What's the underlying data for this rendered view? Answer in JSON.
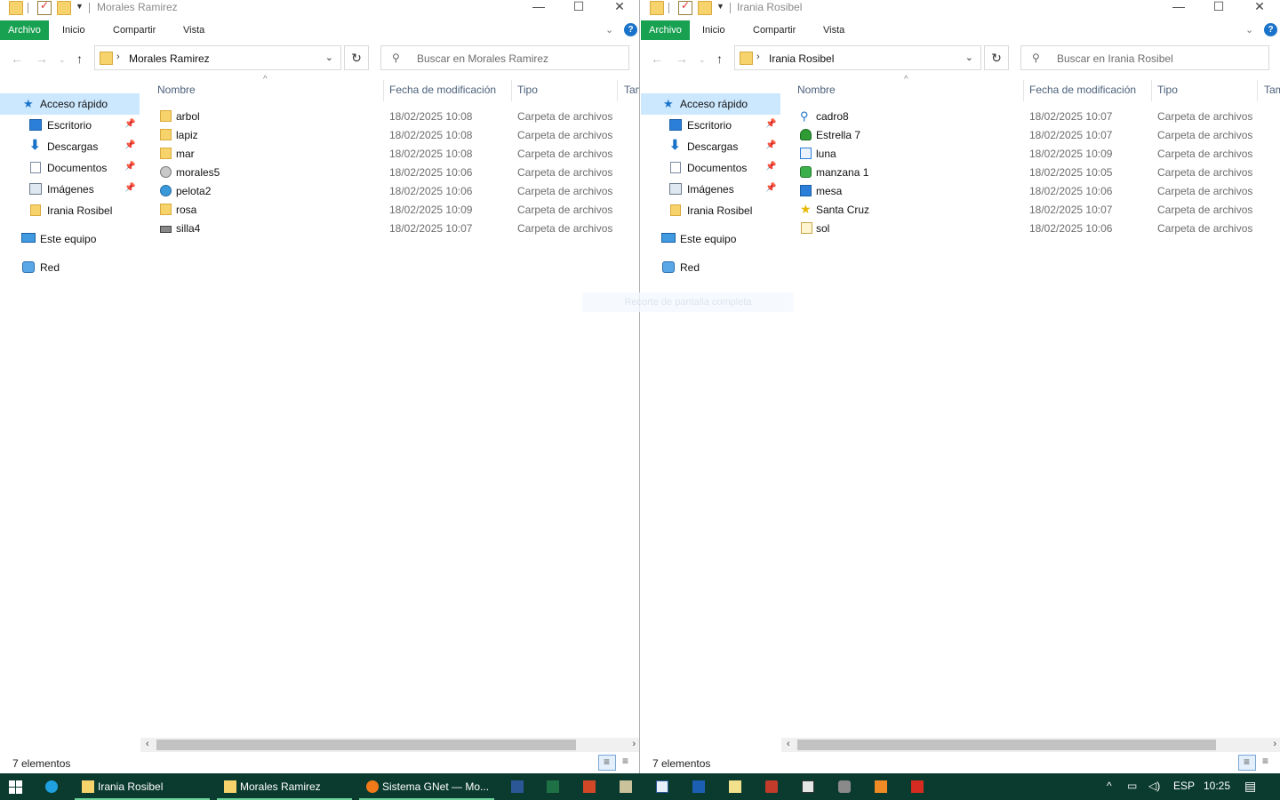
{
  "left": {
    "title": "Morales Ramirez",
    "ribbon": {
      "file": "Archivo",
      "home": "Inicio",
      "share": "Compartir",
      "view": "Vista"
    },
    "address": "Morales Ramirez",
    "search_placeholder": "Buscar en Morales Ramirez",
    "columns": {
      "name": "Nombre",
      "date": "Fecha de modificación",
      "type": "Tipo",
      "size": "Tam"
    },
    "files": [
      {
        "name": "arbol",
        "date": "18/02/2025 10:08",
        "type": "Carpeta de archivos",
        "icon": "folder-icon"
      },
      {
        "name": "lapiz",
        "date": "18/02/2025 10:08",
        "type": "Carpeta de archivos",
        "icon": "folder-icon"
      },
      {
        "name": "mar",
        "date": "18/02/2025 10:08",
        "type": "Carpeta de archivos",
        "icon": "folder-icon"
      },
      {
        "name": "morales5",
        "date": "18/02/2025 10:06",
        "type": "Carpeta de archivos",
        "icon": "disk-icon"
      },
      {
        "name": "pelota2",
        "date": "18/02/2025 10:06",
        "type": "Carpeta de archivos",
        "icon": "globe-icon"
      },
      {
        "name": "rosa",
        "date": "18/02/2025 10:09",
        "type": "Carpeta de archivos",
        "icon": "folder-icon"
      },
      {
        "name": "silla4",
        "date": "18/02/2025 10:07",
        "type": "Carpeta de archivos",
        "icon": "drive-icon"
      }
    ],
    "status": "7 elementos"
  },
  "right": {
    "title": "Irania Rosibel",
    "ribbon": {
      "file": "Archivo",
      "home": "Inicio",
      "share": "Compartir",
      "view": "Vista"
    },
    "address": "Irania Rosibel",
    "search_placeholder": "Buscar en Irania Rosibel",
    "columns": {
      "name": "Nombre",
      "date": "Fecha de modificación",
      "type": "Tipo",
      "size": "Tam"
    },
    "files": [
      {
        "name": "cadro8",
        "date": "18/02/2025 10:07",
        "type": "Carpeta de archivos",
        "icon": "search-icon"
      },
      {
        "name": "Estrella 7",
        "date": "18/02/2025 10:07",
        "type": "Carpeta de archivos",
        "icon": "tree-icon"
      },
      {
        "name": "luna",
        "date": "18/02/2025 10:09",
        "type": "Carpeta de archivos",
        "icon": "card-icon"
      },
      {
        "name": "manzana 1",
        "date": "18/02/2025 10:05",
        "type": "Carpeta de archivos",
        "icon": "network-icon"
      },
      {
        "name": "mesa",
        "date": "18/02/2025 10:06",
        "type": "Carpeta de archivos",
        "icon": "monitor-icon"
      },
      {
        "name": "Santa Cruz",
        "date": "18/02/2025 10:07",
        "type": "Carpeta de archivos",
        "icon": "star-icon"
      },
      {
        "name": "sol",
        "date": "18/02/2025 10:06",
        "type": "Carpeta de archivos",
        "icon": "document-icon"
      }
    ],
    "status": "7 elementos"
  },
  "nav": {
    "quick_access": "Acceso rápido",
    "desktop": "Escritorio",
    "downloads": "Descargas",
    "documents": "Documentos",
    "images": "Imágenes",
    "irania": "Irania Rosibel",
    "this_pc": "Este equipo",
    "network": "Red"
  },
  "ghost_text": "Recorte de pantalla completa",
  "taskbar": {
    "items": [
      "Irania Rosibel",
      "Morales Ramirez",
      "Sistema GNet — Mo..."
    ],
    "lang": "ESP",
    "time": "10:25"
  },
  "colors": {
    "file_tab": "#19a152",
    "taskbar": "#0b3b2e",
    "selection": "#cce8ff"
  }
}
